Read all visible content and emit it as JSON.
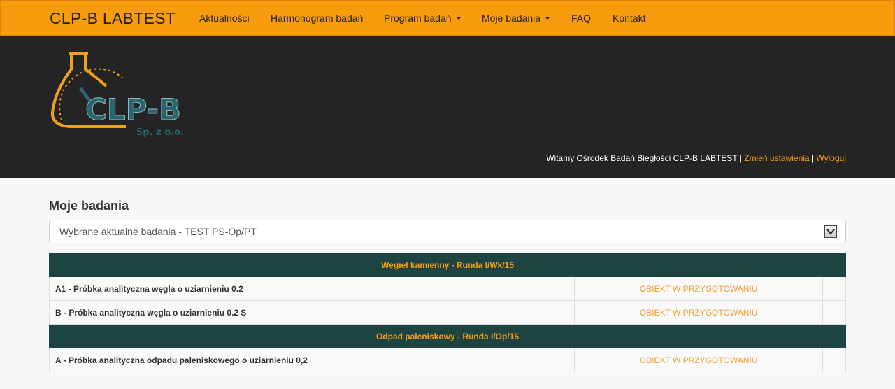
{
  "navbar": {
    "brand": "CLP-B LABTEST",
    "items": [
      {
        "label": "Aktualności",
        "dropdown": false
      },
      {
        "label": "Harmonogram badań",
        "dropdown": false
      },
      {
        "label": "Program badań",
        "dropdown": true
      },
      {
        "label": "Moje badania",
        "dropdown": true
      },
      {
        "label": "FAQ",
        "dropdown": false
      },
      {
        "label": "Kontakt",
        "dropdown": false
      }
    ]
  },
  "logo": {
    "text": "CLP-B",
    "subtext": "Sp. z o.o."
  },
  "welcome": {
    "text": "Witamy Ośrodek Badań Biegłości CLP-B LABTEST",
    "separator": "|",
    "settings_link": "Zmień ustawienia",
    "logout_link": "Wyloguj"
  },
  "main": {
    "title": "Moje badania",
    "select_value": "Wybrane aktualne badania - TEST PS-Op/PT",
    "groups": [
      {
        "header": "Węgiel kamienny - Runda I/Wk/15",
        "rows": [
          {
            "name": "A1 - Próbka analityczna węgla o uziarnieniu 0.2",
            "status": "OBIEKT W PRZYGOTOWANIU"
          },
          {
            "name": "B - Próbka analityczna węgla o uziarnieniu 0.2 S",
            "status": "OBIEKT W PRZYGOTOWANIU"
          }
        ]
      },
      {
        "header": "Odpad paleniskowy - Runda I/Op/15",
        "rows": [
          {
            "name": "A - Próbka analityczna odpadu paleniskowego o uziarnieniu 0,2",
            "status": "OBIEKT W PRZYGOTOWANIU"
          }
        ]
      }
    ]
  },
  "colors": {
    "accent": "#f89c0e",
    "banner": "#242424",
    "table_header": "#1e4442"
  }
}
